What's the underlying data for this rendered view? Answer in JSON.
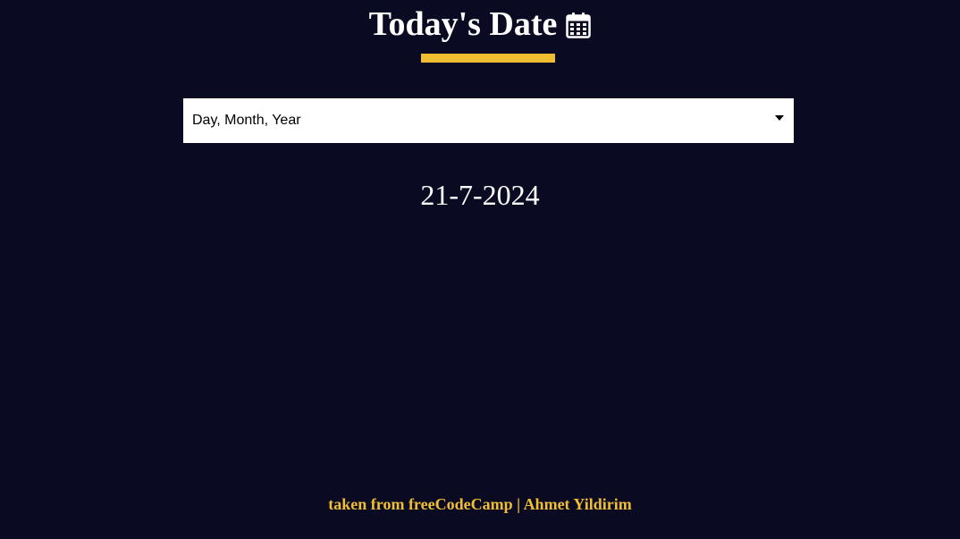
{
  "header": {
    "title": "Today's Date",
    "icon": "calendar-icon"
  },
  "format_select": {
    "selected": "Day, Month, Year"
  },
  "date_display": {
    "value": "21-7-2024"
  },
  "footer": {
    "link_text": "taken from freeCodeCamp",
    "separator": "|",
    "author": "Ahmet Yildirim"
  },
  "colors": {
    "background": "#0a0a23",
    "accent": "#f1be32",
    "text": "#ffffff"
  }
}
